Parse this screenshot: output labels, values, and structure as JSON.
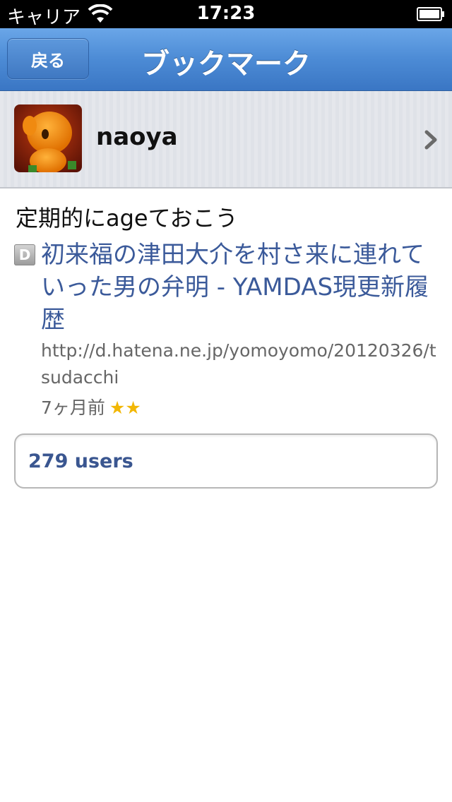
{
  "status_bar": {
    "carrier": "キャリア",
    "time": "17:23"
  },
  "nav": {
    "back_label": "戻る",
    "title": "ブックマーク"
  },
  "user": {
    "name": "naoya"
  },
  "bookmark": {
    "comment": "定期的にageておこう",
    "entry_icon_letter": "D",
    "entry_title": "初来福の津田大介を村さ来に連れていった男の弁明 - YAMDAS現更新履歴",
    "entry_url": "http://d.hatena.ne.jp/yomoyomo/20120326/tsudacchi",
    "date": "7ヶ月前",
    "stars": "★★"
  },
  "users_button": {
    "label": "279 users"
  },
  "colors": {
    "nav_blue": "#4c8bd5",
    "link_blue": "#3b5a9a",
    "star_gold": "#f2b705"
  }
}
